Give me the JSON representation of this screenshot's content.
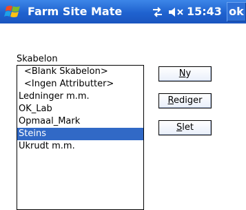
{
  "titlebar": {
    "app_title": "Farm Site Mate",
    "time": "15:43",
    "ok_label": "ok"
  },
  "form": {
    "skabelon_label": "Skabelon",
    "items": [
      "<Blank Skabelon>",
      "<Ingen Attributter>",
      "Ledninger m.m.",
      "OK_Lab",
      "Opmaal_Mark",
      "Steins",
      "Ukrudt m.m."
    ],
    "selected_item": "Steins"
  },
  "buttons": {
    "ny": {
      "accel": "N",
      "rest": "y"
    },
    "rediger": {
      "accel": "R",
      "rest": "ediger"
    },
    "slet": {
      "accel": "S",
      "rest": "let"
    }
  },
  "colors": {
    "titlebar": "#1f62cf",
    "selection": "#3169c6"
  }
}
